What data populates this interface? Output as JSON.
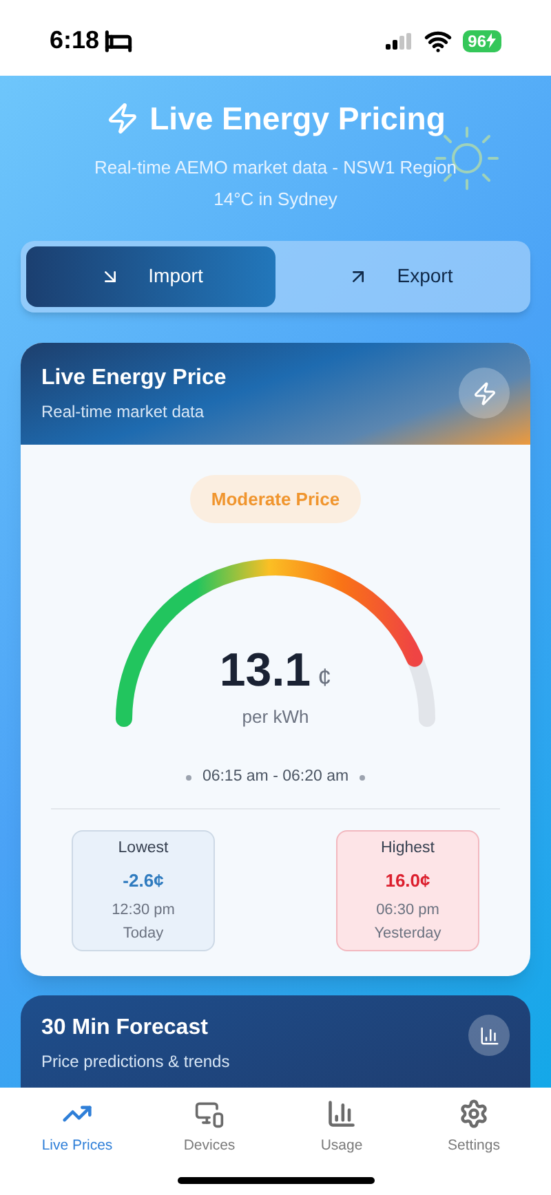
{
  "status_bar": {
    "time": "6:18",
    "battery": "96"
  },
  "header": {
    "title": "Live Energy Pricing",
    "subtitle": "Real-time AEMO market data - NSW1 Region",
    "weather": "14°C in Sydney"
  },
  "direction_tabs": [
    {
      "label": "Import",
      "kind": "import",
      "selected": true
    },
    {
      "label": "Export",
      "kind": "export",
      "selected": false
    }
  ],
  "price_card": {
    "title": "Live Energy Price",
    "subtitle": "Real-time market data",
    "badge": "Moderate Price",
    "price": "13.1",
    "unit": "¢",
    "per": "per kWh",
    "interval": "06:15 am - 06:20 am",
    "stats": [
      {
        "kind": "low",
        "label": "Lowest",
        "value": "-2.6¢",
        "time": "12:30 pm",
        "day": "Today"
      },
      {
        "kind": "high",
        "label": "Highest",
        "value": "16.0¢",
        "time": "06:30 pm",
        "day": "Yesterday"
      }
    ]
  },
  "forecast_card": {
    "title": "30 Min Forecast",
    "subtitle": "Price predictions & trends"
  },
  "nav": [
    {
      "label": "Live Prices",
      "kind": "live",
      "selected": true
    },
    {
      "label": "Devices",
      "kind": "devices",
      "selected": false
    },
    {
      "label": "Usage",
      "kind": "usage",
      "selected": false
    },
    {
      "label": "Settings",
      "kind": "settings",
      "selected": false
    }
  ]
}
